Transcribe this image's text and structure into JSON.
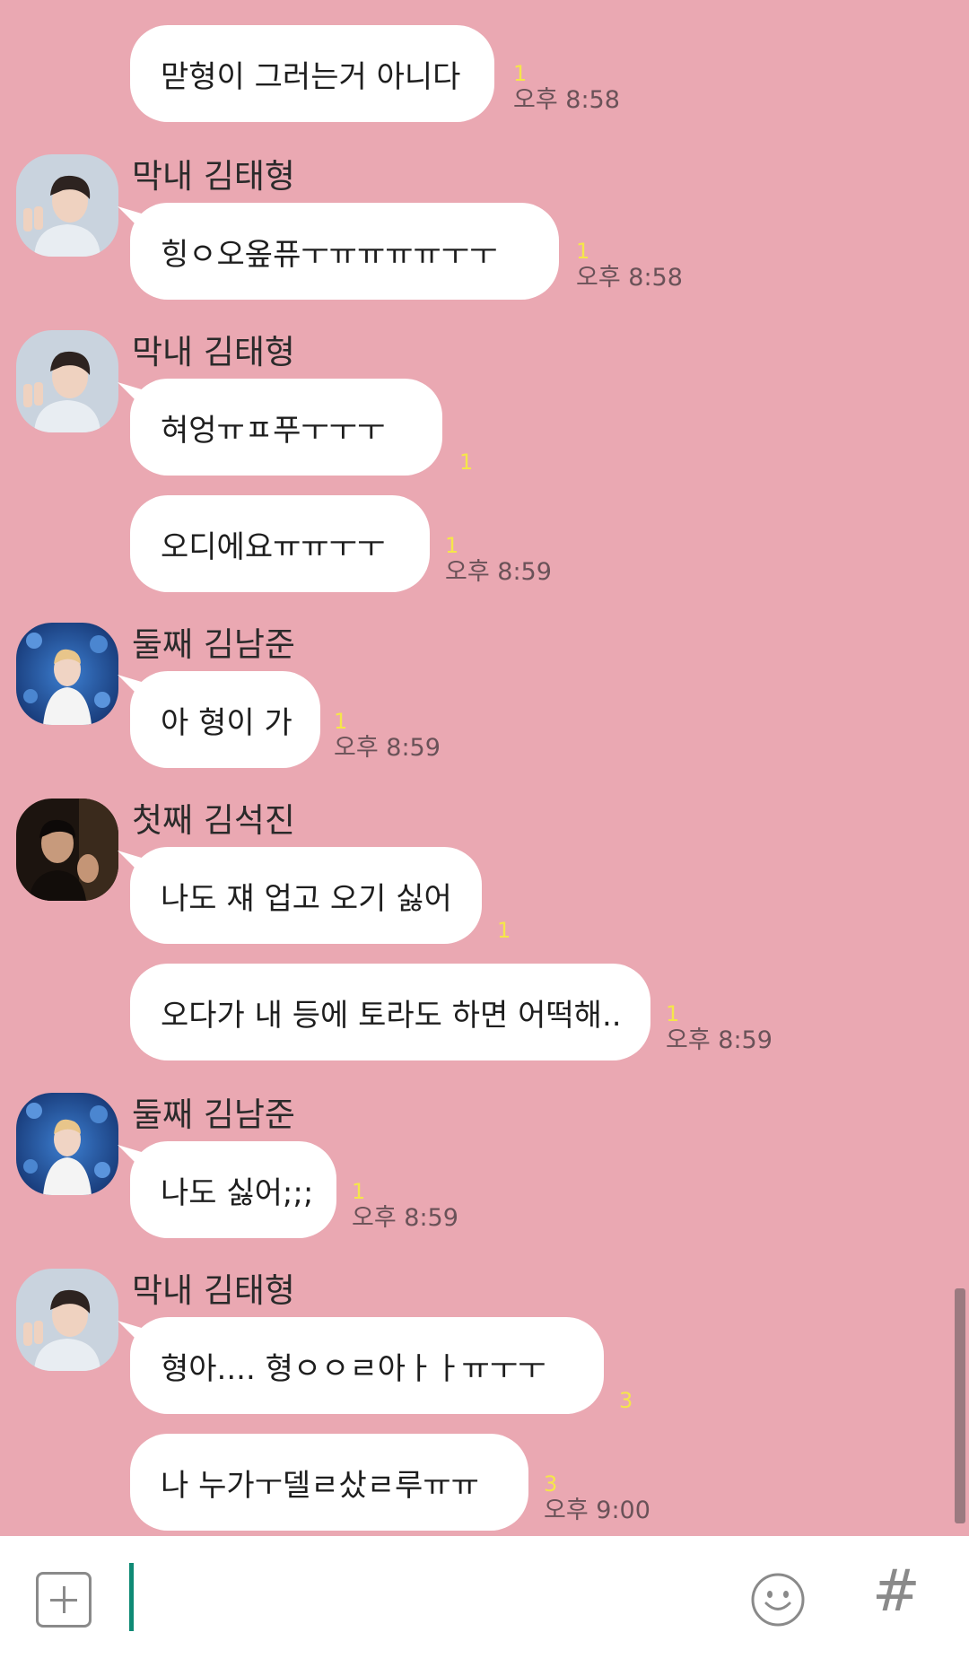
{
  "messages": [
    {
      "text": "맏형이 그러는거 아니다",
      "unread": "1",
      "time": "오후 8:58"
    },
    {
      "sender": "막내 김태형",
      "text": "힝ㅇ오옾퓨ㅜㅠㅠㅠㅠㅜㅜ",
      "unread": "1",
      "time": "오후 8:58"
    },
    {
      "sender": "막내 김태형",
      "text": "혀엉ㅠㅍ푸ㅜㅜㅜ",
      "unread": "1"
    },
    {
      "text": "오디에요ㅠㅠㅜㅜ",
      "unread": "1",
      "time": "오후 8:59"
    },
    {
      "sender": "둘째 김남준",
      "text": "아 형이 가",
      "unread": "1",
      "time": "오후 8:59"
    },
    {
      "sender": "첫째 김석진",
      "text": "나도 쟤 업고 오기 싫어",
      "unread": "1"
    },
    {
      "text": "오다가 내 등에 토라도 하면 어떡해..",
      "unread": "1",
      "time": "오후 8:59"
    },
    {
      "sender": "둘째 김남준",
      "text": "나도 싫어;;;",
      "unread": "1",
      "time": "오후 8:59"
    },
    {
      "sender": "막내 김태형",
      "text": "형아.... 형ㅇㅇㄹ아ㅏㅏㅠㅜㅜ",
      "unread": "3"
    },
    {
      "text": "나 누가ㅜ델ㄹ샀ㄹ루ㅠㅠ",
      "unread": "3",
      "time": "오후 9:00"
    }
  ],
  "input": {
    "value": "",
    "placeholder": ""
  },
  "icons": {
    "attach": "plus-square-icon",
    "emoji": "smiley-icon",
    "hashtag": "hashtag-icon"
  },
  "colors": {
    "background": "#eaa8b2",
    "bubble": "#ffffff",
    "unread": "#f5e64a",
    "cursor": "#0f8a75"
  }
}
